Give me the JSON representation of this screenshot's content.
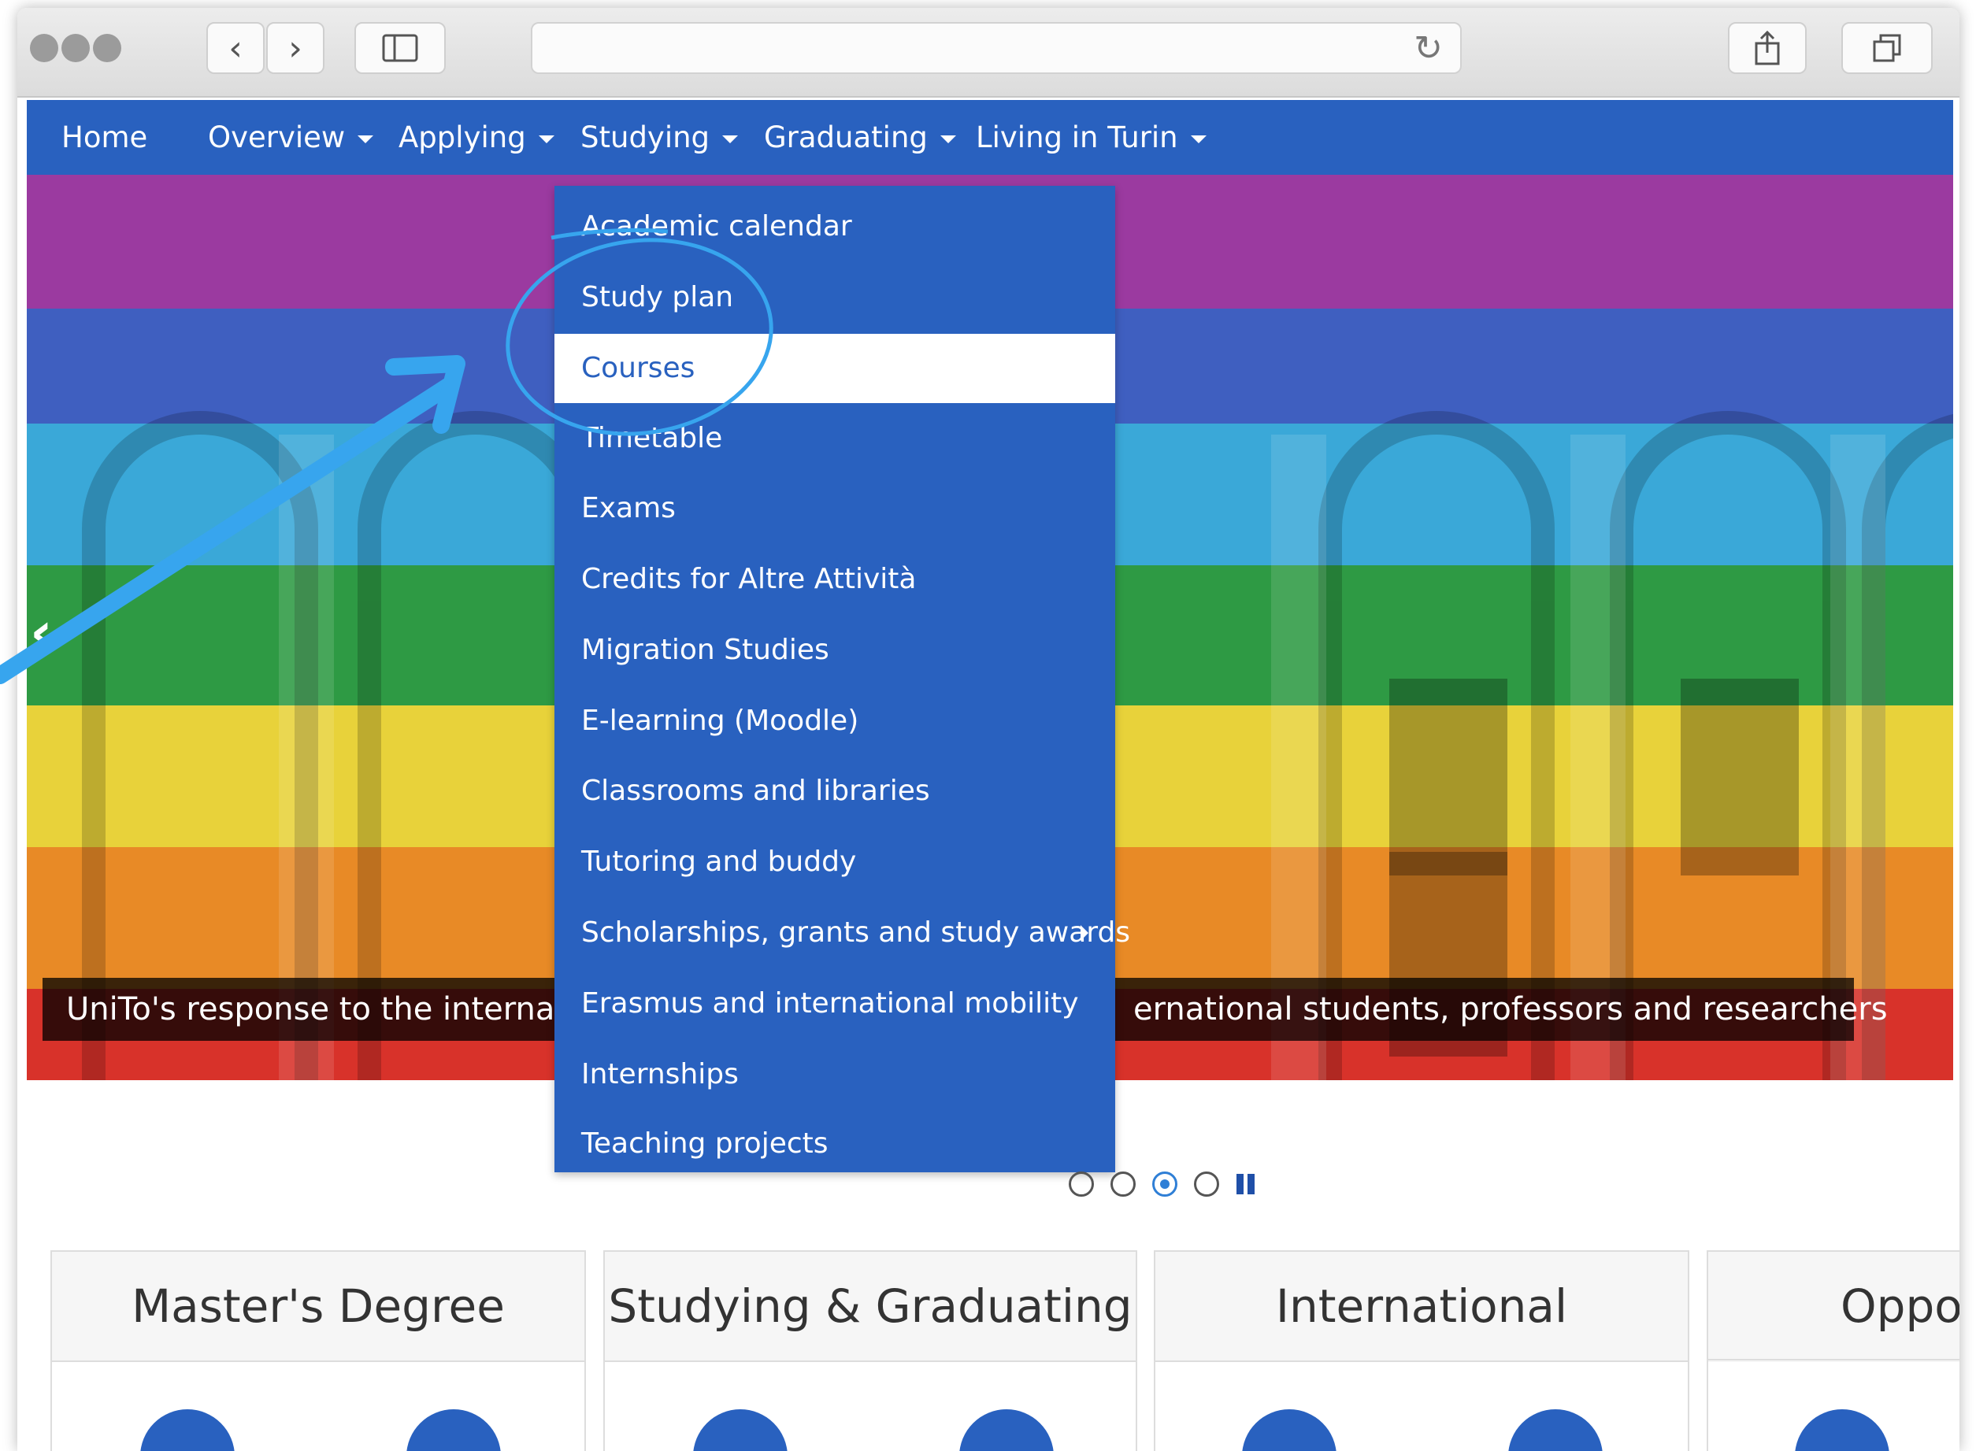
{
  "browser": {
    "url": "",
    "sidebar_icon": "sidebar-icon",
    "share_icon": "share-icon",
    "tabs_icon": "tabs-icon",
    "back_glyph": "‹",
    "forward_glyph": "›",
    "reload_glyph": "↻"
  },
  "nav": {
    "items": [
      {
        "label": "Home",
        "has_caret": false
      },
      {
        "label": "Overview",
        "has_caret": true
      },
      {
        "label": "Applying",
        "has_caret": true
      },
      {
        "label": "Studying",
        "has_caret": true
      },
      {
        "label": "Graduating",
        "has_caret": true
      },
      {
        "label": "Living in Turin",
        "has_caret": true
      }
    ]
  },
  "dropdown": {
    "items": [
      {
        "label": "Academic calendar"
      },
      {
        "label": "Study plan"
      },
      {
        "label": "Courses",
        "active": true
      },
      {
        "label": "Timetable"
      },
      {
        "label": "Exams"
      },
      {
        "label": "Credits for Altre Attività"
      },
      {
        "label": "Migration Studies"
      },
      {
        "label": "E-learning (Moodle)"
      },
      {
        "label": "Classrooms and libraries"
      },
      {
        "label": "Tutoring and buddy"
      },
      {
        "label": "Scholarships, grants and study awards",
        "has_submenu": true
      },
      {
        "label": "Erasmus and international mobility"
      },
      {
        "label": "Internships"
      },
      {
        "label": "Teaching projects"
      }
    ]
  },
  "hero": {
    "caption_left": "UniTo's response to the internation",
    "caption_right": "ernational students, professors and researchers",
    "prev_glyph": "‹",
    "bands": [
      "#9b3aa0",
      "#3f5fc0",
      "#3aa8d8",
      "#2e9a44",
      "#e8d23a",
      "#e88a26",
      "#d8322a"
    ],
    "slide_count": 4,
    "active_slide": 3
  },
  "cards": [
    {
      "title": "Master's Degree",
      "icons": [
        "lightbulb-icon",
        "graduation-cap-icon"
      ]
    },
    {
      "title": "Studying & Graduating",
      "icons": [
        "book-icon",
        "clock-icon"
      ]
    },
    {
      "title": "International",
      "icons": [
        "globe-icon",
        "globe-icon"
      ]
    },
    {
      "title": "Oppor",
      "icons": [
        "pencil-icon"
      ]
    }
  ],
  "colors": {
    "nav_blue": "#2961bf",
    "annotation_blue": "#37a5ee"
  }
}
